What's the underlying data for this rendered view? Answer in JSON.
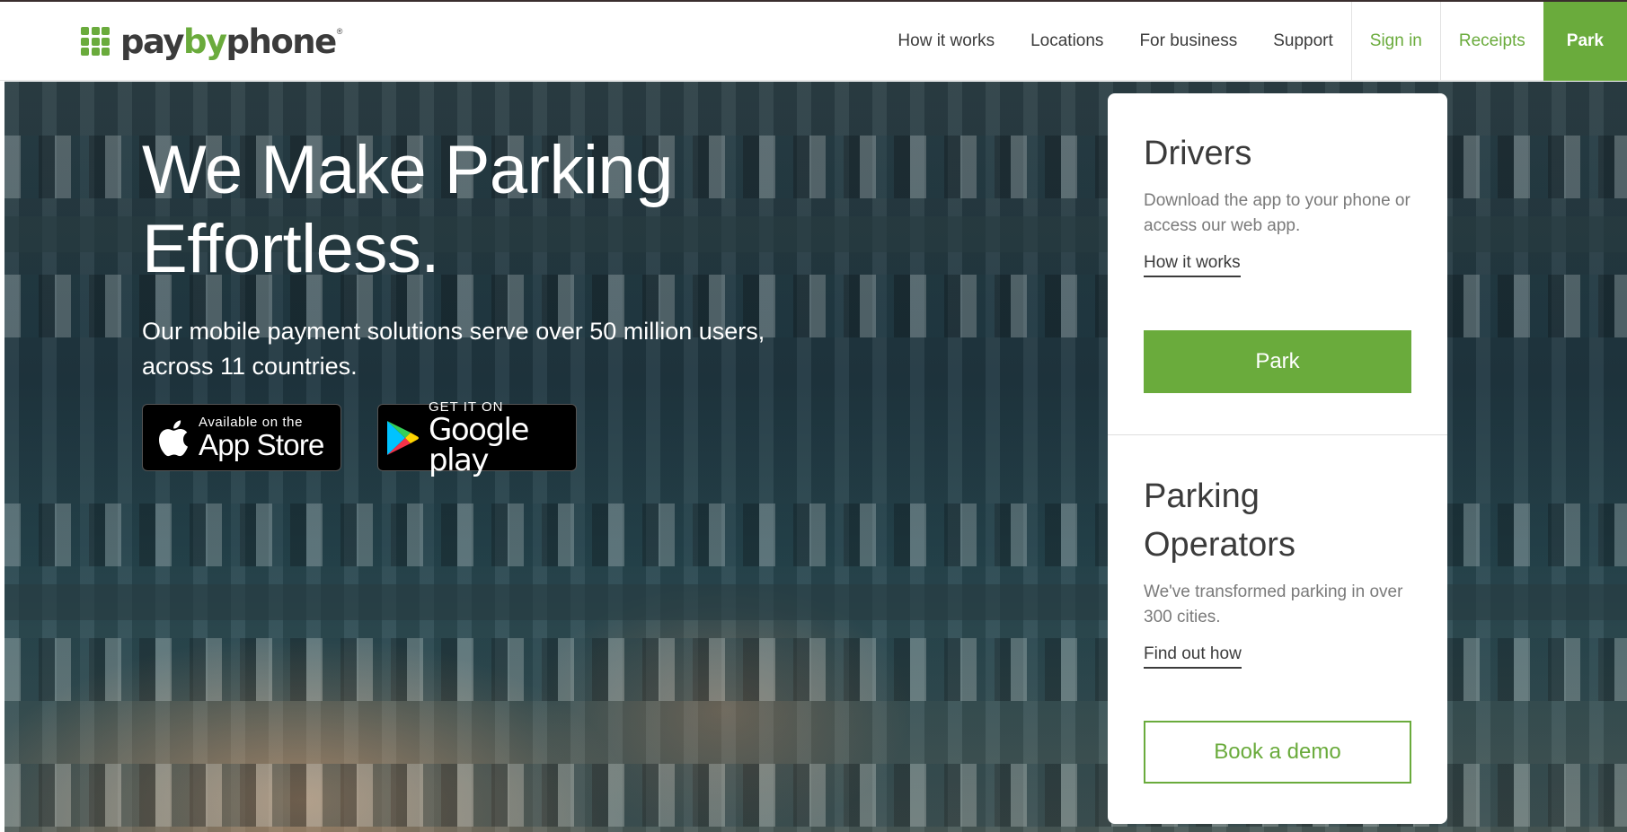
{
  "brand": {
    "name_pre": "pay",
    "name_mid": "by",
    "name_post": "phone",
    "reg": "®",
    "green": "#6aab3c"
  },
  "nav": {
    "how_it_works": "How it works",
    "locations": "Locations",
    "for_business": "For business",
    "support": "Support",
    "sign_in": "Sign in",
    "receipts": "Receipts",
    "park": "Park"
  },
  "hero": {
    "title": "We Make Parking Effortless.",
    "subtitle": "Our mobile payment solutions serve over 50 million users, across 11 countries.",
    "app_store": {
      "small": "Available on the",
      "big": "App Store",
      "icon": "apple-icon"
    },
    "google_play": {
      "small": "GET IT ON",
      "big": "Google play",
      "icon": "google-play-icon"
    }
  },
  "drivers": {
    "heading": "Drivers",
    "text": "Download the app to your phone or access our web app.",
    "link": "How it works",
    "button": "Park"
  },
  "operators": {
    "heading": "Parking Operators",
    "text": "We've transformed parking in over 300 cities.",
    "link": "Find out how",
    "button": "Book a demo"
  }
}
